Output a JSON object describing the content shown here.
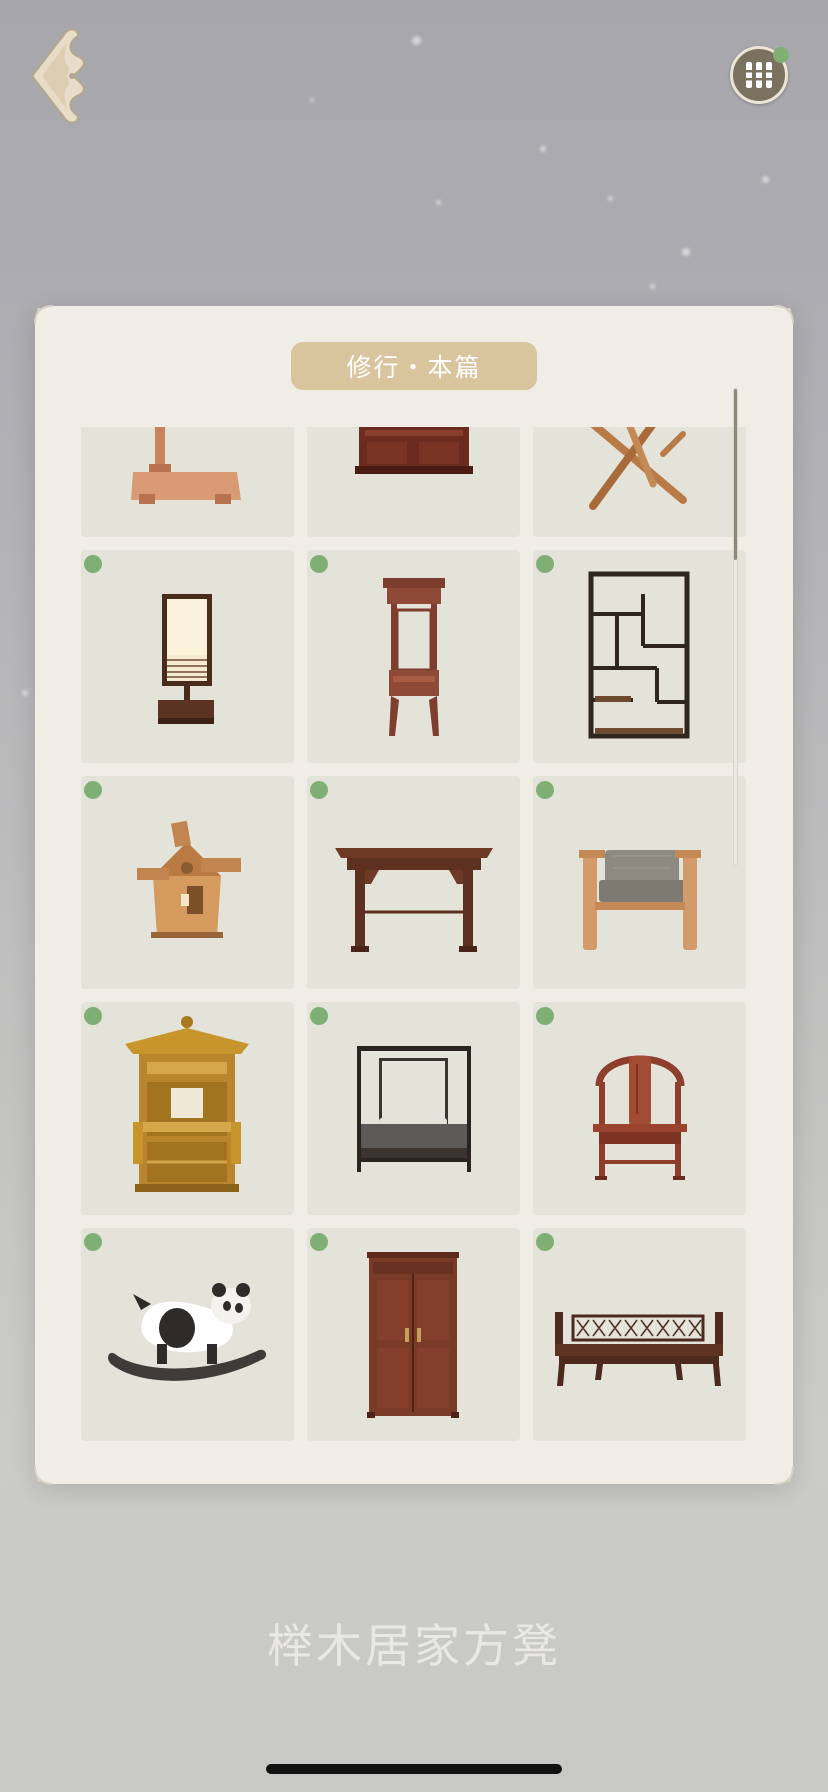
{
  "header": {
    "back_icon": "ornate-back-arrow-icon",
    "menu_icon": "grid-menu-icon",
    "menu_has_notification": true
  },
  "panel": {
    "title": "修行・本篇"
  },
  "items": [
    {
      "name": "lamp-stand-base",
      "unlocked": false
    },
    {
      "name": "dark-wood-cabinet-base",
      "unlocked": false
    },
    {
      "name": "crossed-leg-stand",
      "unlocked": false
    },
    {
      "name": "paper-table-lamp",
      "unlocked": true
    },
    {
      "name": "carved-plant-stand",
      "unlocked": true
    },
    {
      "name": "curio-display-shelf",
      "unlocked": true
    },
    {
      "name": "wooden-windmill",
      "unlocked": true
    },
    {
      "name": "recessed-leg-side-table",
      "unlocked": true
    },
    {
      "name": "cushioned-armchair",
      "unlocked": true
    },
    {
      "name": "carved-sedan-chair",
      "unlocked": true
    },
    {
      "name": "canopy-bed",
      "unlocked": true
    },
    {
      "name": "horseshoe-back-armchair",
      "unlocked": true
    },
    {
      "name": "panda-rocking-horse",
      "unlocked": true
    },
    {
      "name": "tall-wardrobe",
      "unlocked": true
    },
    {
      "name": "lattice-back-daybed",
      "unlocked": true
    }
  ],
  "scrollbar": {
    "position": 0.36
  },
  "selected_item_name": "榉木居家方凳",
  "colors": {
    "unlocked_dot": "#7faf75",
    "tag_bg": "#d8c59d",
    "panel_bg": "#f0ede7",
    "cell_bg": "#e3e3da"
  }
}
